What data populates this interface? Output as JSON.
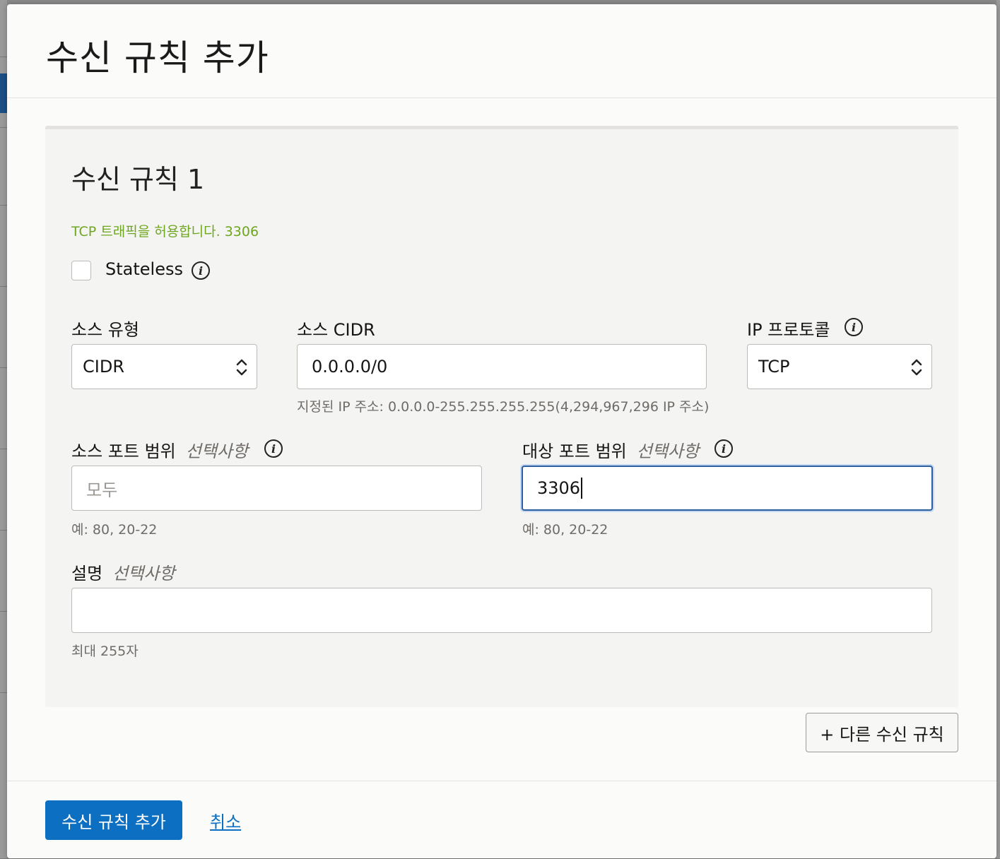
{
  "modal": {
    "title": "수신 규칙 추가"
  },
  "rule": {
    "title": "수신 규칙 1",
    "summary": "TCP 트래픽을 허용합니다. 3306",
    "stateless_label": "Stateless",
    "source_type": {
      "label": "소스 유형",
      "value": "CIDR"
    },
    "source_cidr": {
      "label": "소스 CIDR",
      "value": "0.0.0.0/0",
      "hint": "지정된 IP 주소: 0.0.0.0-255.255.255.255(4,294,967,296 IP 주소)"
    },
    "ip_protocol": {
      "label": "IP 프로토콜",
      "value": "TCP"
    },
    "source_port": {
      "label": "소스 포트 범위",
      "optional": "선택사항",
      "placeholder": "모두",
      "hint": "예: 80, 20-22"
    },
    "dest_port": {
      "label": "대상 포트 범위",
      "optional": "선택사항",
      "value": "3306",
      "hint": "예: 80, 20-22"
    },
    "description": {
      "label": "설명",
      "optional": "선택사항",
      "hint": "최대 255자"
    }
  },
  "add_another_label": "+ 다른 수신 규칙",
  "footer": {
    "submit_label": "수신 규칙 추가",
    "cancel_label": "취소"
  },
  "colors": {
    "primary": "#0d6fc2",
    "success_text": "#6ea61f",
    "focus_border": "#2c5fa0"
  }
}
